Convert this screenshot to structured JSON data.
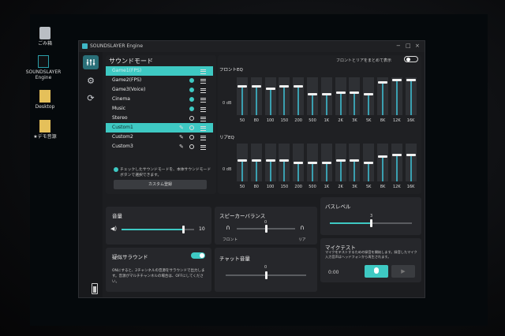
{
  "desktop": {
    "icons": [
      {
        "label": "ごみ箱"
      },
      {
        "label": "SOUNDSLAYER Engine"
      },
      {
        "label": "Desktop"
      },
      {
        "label": "★デモ音源"
      }
    ]
  },
  "window": {
    "title": "SOUNDSLAYER Engine",
    "minimize": "−",
    "maximize": "□",
    "close": "×"
  },
  "sound_mode": {
    "heading": "サウンドモード",
    "items": [
      {
        "name": "Game1(FPS)",
        "selected": true,
        "editable": false
      },
      {
        "name": "Game2(FPS)",
        "selected": false,
        "editable": false
      },
      {
        "name": "Game3(Voice)",
        "selected": false,
        "editable": false
      },
      {
        "name": "Cinema",
        "selected": false,
        "editable": false
      },
      {
        "name": "Music",
        "selected": false,
        "editable": false
      },
      {
        "name": "Stereo",
        "selected": false,
        "editable": false
      },
      {
        "name": "Custom1",
        "selected": false,
        "editable": true,
        "highlight": true
      },
      {
        "name": "Custom2",
        "selected": false,
        "editable": true
      },
      {
        "name": "Custom3",
        "selected": false,
        "editable": true
      }
    ],
    "note": "チェックしたサウンドモードを、本体サウンドモードボタンで選択できます。",
    "register_button": "カスタム登録"
  },
  "eq": {
    "sync_label": "フロントとリアをまとめて表示",
    "sync_on": false,
    "front_label": "フロントEQ",
    "rear_label": "リアEQ",
    "zero_label": "0 dB",
    "bands": [
      "50",
      "80",
      "100",
      "150",
      "200",
      "500",
      "1K",
      "2K",
      "3K",
      "5K",
      "8K",
      "12K",
      "16K"
    ],
    "front_levels": [
      5,
      5,
      4,
      5,
      5,
      1,
      1,
      2,
      2,
      1,
      7,
      8,
      8
    ],
    "rear_levels": [
      1,
      1,
      1,
      1,
      0,
      0,
      0,
      1,
      1,
      0,
      3,
      4,
      4
    ]
  },
  "volume": {
    "label": "音量",
    "value": "10",
    "level": 0.85
  },
  "speaker_balance": {
    "label": "スピーカーバランス",
    "value": "0",
    "front": "フロント",
    "rear": "リア",
    "level": 0.5
  },
  "bass_level": {
    "label": "バスレベル",
    "value": "3",
    "level": 0.5
  },
  "virtual_surround": {
    "label": "疑似サラウンド",
    "on": true,
    "note": "ONにすると、2チャンネルの音源をサラウンドで出力します。音源がマルチチャンネルの場合は、OFFにしてください。"
  },
  "chat_volume": {
    "label": "チャット音量",
    "value": "0",
    "level": 0.5
  },
  "mic_test": {
    "label": "マイクテスト",
    "note": "マイクをテストするための録音を開始します。録音したマイク入力音声はヘッドフォンから再生されます。",
    "time": "0:00"
  },
  "colors": {
    "accent": "#3ec9c3",
    "eq_track": "#3a9fb0"
  }
}
